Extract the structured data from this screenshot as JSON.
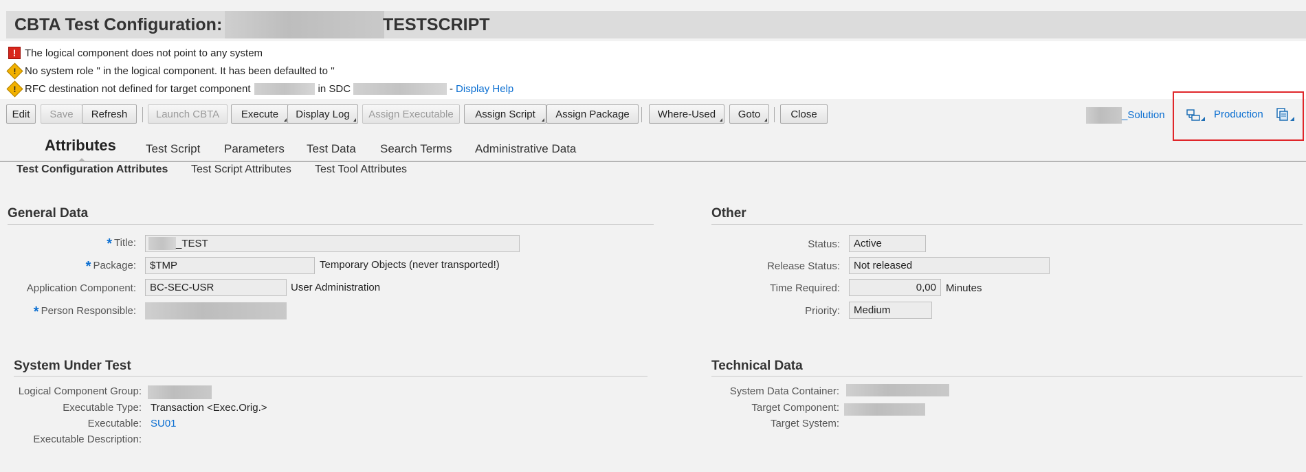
{
  "window": {
    "title_prefix": "CBTA Test Configuration:",
    "title_suffix": "TESTSCRIPT"
  },
  "messages": [
    {
      "type": "error",
      "text": "The logical component does not point to any system"
    },
    {
      "type": "warning",
      "text": "No system role '' in the logical component. It has been defaulted to ''"
    },
    {
      "type": "warning",
      "text_a": "RFC destination not defined for target component",
      "text_b": "in SDC",
      "text_c": "-",
      "link": "Display Help"
    }
  ],
  "toolbar": {
    "edit": "Edit",
    "save": "Save",
    "refresh": "Refresh",
    "launch_cbta": "Launch CBTA",
    "execute": "Execute",
    "display_log": "Display Log",
    "assign_executable": "Assign Executable",
    "assign_script": "Assign Script",
    "assign_package": "Assign Package",
    "where_used": "Where-Used",
    "goto": "Goto",
    "close": "Close"
  },
  "header_right": {
    "solution": "_Solution",
    "branch": "Production"
  },
  "tabs": [
    "Attributes",
    "Test Script",
    "Parameters",
    "Test Data",
    "Search Terms",
    "Administrative Data"
  ],
  "subtabs": [
    "Test Configuration Attributes",
    "Test Script Attributes",
    "Test Tool Attributes"
  ],
  "general_data": {
    "heading": "General Data",
    "title_label": "Title:",
    "title_value": "_TEST",
    "package_label": "Package:",
    "package_value": "$TMP",
    "package_desc": "Temporary Objects (never transported!)",
    "app_comp_label": "Application Component:",
    "app_comp_value": "BC-SEC-USR",
    "app_comp_desc": "User Administration",
    "person_label": "Person Responsible:"
  },
  "other": {
    "heading": "Other",
    "status_label": "Status:",
    "status_value": "Active",
    "release_label": "Release Status:",
    "release_value": "Not released",
    "time_label": "Time Required:",
    "time_value": "0,00",
    "time_unit": "Minutes",
    "priority_label": "Priority:",
    "priority_value": "Medium"
  },
  "system_under_test": {
    "heading": "System Under Test",
    "lcg_label": "Logical Component Group:",
    "exec_type_label": "Executable Type:",
    "exec_type_value": "Transaction <Exec.Orig.>",
    "executable_label": "Executable:",
    "executable_value": "SU01",
    "exec_desc_label": "Executable Description:"
  },
  "technical_data": {
    "heading": "Technical Data",
    "sdc_label": "System Data Container:",
    "target_comp_label": "Target Component:",
    "target_sys_label": "Target System:"
  }
}
